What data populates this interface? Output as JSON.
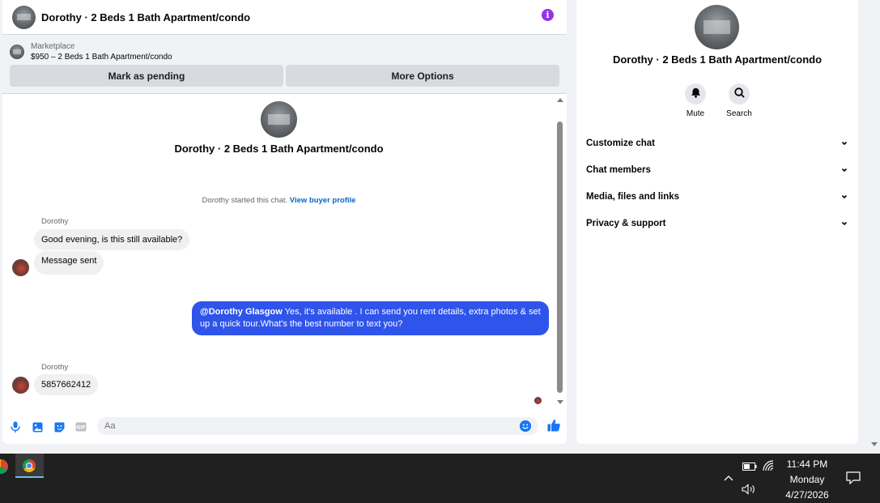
{
  "header": {
    "title": "Dorothy · 2 Beds 1 Bath Apartment/condo",
    "info_icon": "info-icon"
  },
  "marketplace": {
    "label": "Marketplace",
    "listing": "$950 – 2 Beds 1 Bath Apartment/condo",
    "buttons": {
      "mark_pending": "Mark as pending",
      "more_options": "More Options"
    }
  },
  "intro": {
    "name": "Dorothy · 2 Beds 1 Bath Apartment/condo",
    "started_text": "Dorothy started this chat.",
    "buyer_profile_link": "View buyer profile"
  },
  "messages": [
    {
      "sender": "Dorothy",
      "text": "Good evening, is this still available?"
    },
    {
      "text": "Message sent"
    },
    {
      "mention": "@Dorothy Glasgow",
      "text": " Yes, it's available .  I can send you rent details, extra photos & set up a quick tour.What's the best number to text you?",
      "outgoing": true
    },
    {
      "sender": "Dorothy",
      "text": "5857662412"
    }
  ],
  "composer": {
    "placeholder": "Aa",
    "icons": [
      "mic-icon",
      "image-icon",
      "sticker-icon",
      "gif-icon",
      "emoji-icon",
      "thumbs-up-icon"
    ]
  },
  "right_panel": {
    "name": "Dorothy · 2 Beds 1 Bath Apartment/condo",
    "actions": {
      "mute": "Mute",
      "search": "Search"
    },
    "menu": [
      {
        "label": "Customize chat"
      },
      {
        "label": "Chat members"
      },
      {
        "label": "Media, files and links"
      },
      {
        "label": "Privacy & support"
      }
    ]
  },
  "taskbar": {
    "time": "11:44 PM",
    "day": "Monday",
    "date": "4/27/2026"
  },
  "colors": {
    "accent": "#1877f2",
    "outgoing_bubble": "#2f54eb",
    "info": "#9333ea"
  }
}
